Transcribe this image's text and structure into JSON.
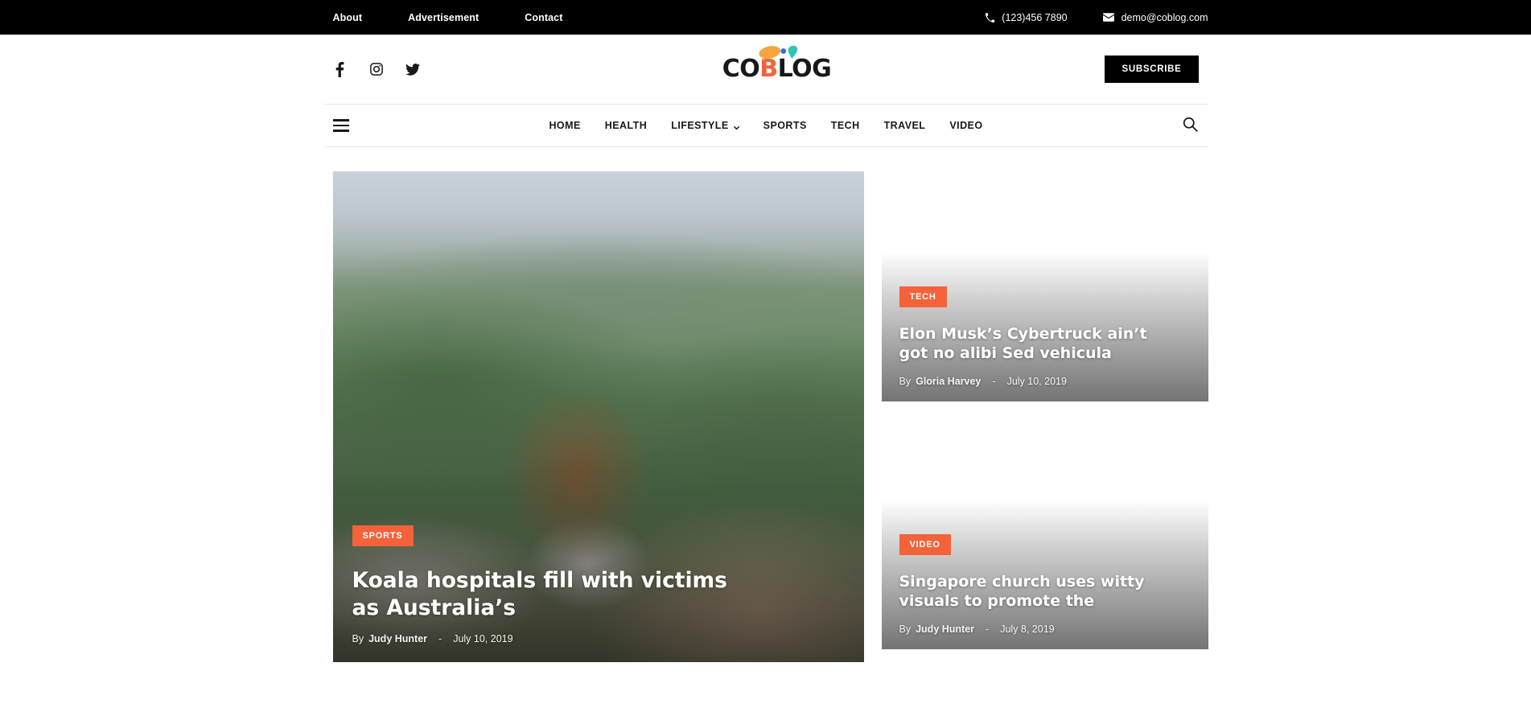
{
  "topbar": {
    "links": [
      {
        "label": "About"
      },
      {
        "label": "Advertisement"
      },
      {
        "label": "Contact"
      }
    ],
    "phone": "(123)456 7890",
    "email": "demo@coblog.com",
    "phone_icon": "phone-icon",
    "email_icon": "envelope-icon",
    "background": "#000000"
  },
  "header": {
    "socials": [
      {
        "name": "facebook-icon",
        "label": "Facebook"
      },
      {
        "name": "instagram-icon",
        "label": "Instagram"
      },
      {
        "name": "twitter-icon",
        "label": "Twitter"
      }
    ],
    "logo": {
      "part1": "CO",
      "accent": "B",
      "part2": "LOG",
      "full": "COBLOG",
      "accent_color": "#f4623a",
      "dot_blue": "#2e6ff2",
      "leaf_teal": "#2ec4b6",
      "leaf_orange": "#f7a340"
    },
    "subscribe_label": "SUBSCRIBE"
  },
  "nav": {
    "menu_icon": "hamburger-icon",
    "search_icon": "search-icon",
    "items": [
      {
        "label": "HOME",
        "has_dropdown": false
      },
      {
        "label": "HEALTH",
        "has_dropdown": false
      },
      {
        "label": "LIFESTYLE",
        "has_dropdown": true
      },
      {
        "label": "SPORTS",
        "has_dropdown": false
      },
      {
        "label": "TECH",
        "has_dropdown": false
      },
      {
        "label": "TRAVEL",
        "has_dropdown": false
      },
      {
        "label": "VIDEO",
        "has_dropdown": false
      }
    ]
  },
  "featured": {
    "main": {
      "category": "SPORTS",
      "title": "Koala hospitals fill with victims as Australia’s",
      "by_label": "By",
      "author": "Judy Hunter",
      "separator": "-",
      "date": "July 10, 2019",
      "image_alt": "woman-sitting-on-wall-overlooking-green-hills"
    },
    "side": [
      {
        "category": "TECH",
        "title": "Elon Musk’s Cybertruck ain’t got no alibi Sed vehicula",
        "by_label": "By",
        "author": "Gloria Harvey",
        "separator": "-",
        "date": "July 10, 2019",
        "image_alt": "feet-in-black-sneakers-on-red-running-track"
      },
      {
        "category": "VIDEO",
        "title": "Singapore church uses witty visuals to promote the",
        "by_label": "By",
        "author": "Judy Hunter",
        "separator": "-",
        "date": "July 8, 2019",
        "image_alt": "runner-on-yellow-striped-crosswalk"
      }
    ]
  },
  "theme": {
    "accent": "#f4623a",
    "text": "#17181a",
    "border": "#e9e9e9",
    "background": "#ffffff"
  }
}
